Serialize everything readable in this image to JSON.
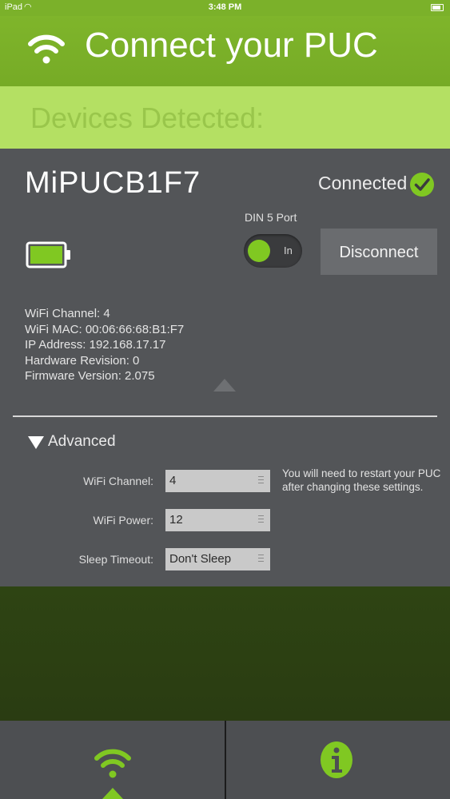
{
  "status_bar": {
    "carrier": "iPad",
    "time": "3:48 PM"
  },
  "header": {
    "title": "Connect your PUC",
    "icon": "wifi-icon"
  },
  "devices_band": {
    "title": "Devices Detected:"
  },
  "device": {
    "name": "MiPUCB1F7",
    "status": "Connected",
    "battery_level": 1.0,
    "din_label": "DIN 5 Port",
    "din_toggle": "In",
    "disconnect_label": "Disconnect",
    "info": [
      "WiFi Channel: 4",
      "WiFi MAC: 00:06:66:68:B1:F7",
      "IP Address: 192.168.17.17",
      "Hardware Revision: 0",
      "Firmware Version: 2.075"
    ]
  },
  "advanced": {
    "label": "Advanced",
    "settings": [
      {
        "label": "WiFi Channel:",
        "value": "4"
      },
      {
        "label": "WiFi Power:",
        "value": "12"
      },
      {
        "label": "Sleep Timeout:",
        "value": "Don't Sleep"
      }
    ],
    "note": "You will need to restart your PUC after changing these settings."
  },
  "tabs": [
    {
      "name": "connect",
      "icon": "wifi-icon",
      "active": true
    },
    {
      "name": "info",
      "icon": "info-icon",
      "active": false
    }
  ],
  "colors": {
    "accent_green": "#80c822",
    "header_green": "#7bb12a",
    "band_green": "#b4e063",
    "card_gray": "#535558"
  }
}
